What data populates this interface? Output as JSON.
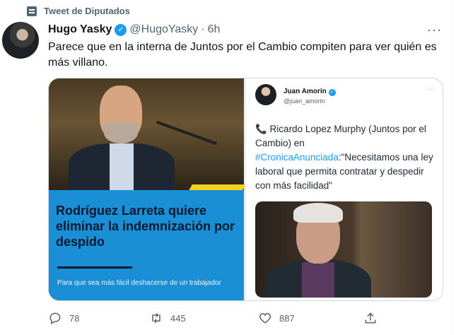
{
  "social_context": {
    "label": "Tweet de Diputados",
    "icon": "list-icon"
  },
  "author": {
    "name": "Hugo Yasky",
    "handle": "@HugoYasky",
    "separator": "·",
    "time": "6h",
    "verified": true
  },
  "more_label": "···",
  "tweet_text": "Parece que en la interna de Juntos por el Cambio compiten para ver quién es más villano.",
  "media": {
    "left": {
      "headline": "Rodríguez Larreta quiere eliminar la indemnización por despido",
      "subtitle": "Para que sea más fácil deshacerse de un trabajador",
      "banner_color": "#1a8fd6"
    },
    "right": {
      "name": "Juan Amorín",
      "handle": "@juan_amorin",
      "more": "···",
      "text_before": "📞 Ricardo Lopez Murphy (Juntos por el Cambio) en ",
      "hashtag": "#CronicaAnunciada",
      "text_after": ":\"Necesitamos una ley laboral que permita contratar y despedir con más facilidad\""
    }
  },
  "actions": {
    "reply": {
      "count": "78",
      "icon": "reply-icon"
    },
    "retweet": {
      "count": "445",
      "icon": "retweet-icon"
    },
    "like": {
      "count": "887",
      "icon": "heart-icon"
    },
    "share": {
      "icon": "share-icon"
    }
  },
  "colors": {
    "accent": "#1d9bf0",
    "muted": "#536471",
    "text": "#0f1419"
  }
}
